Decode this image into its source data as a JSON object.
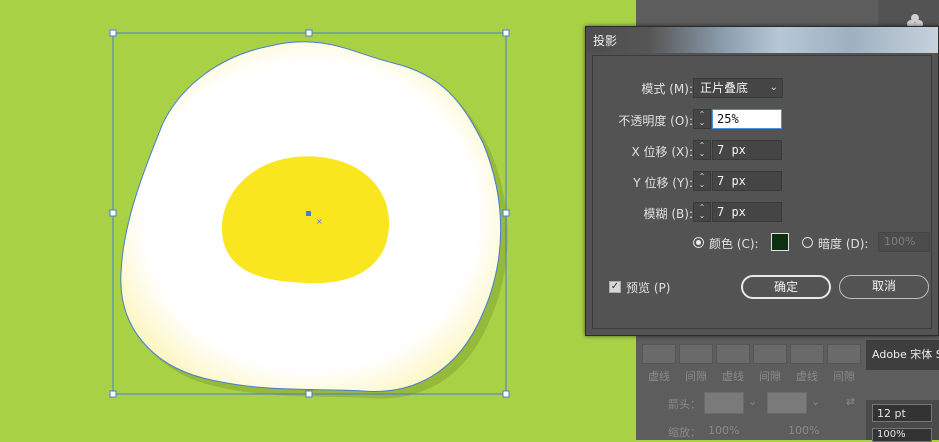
{
  "dialog": {
    "title": "投影",
    "mode_label": "模式 (M):",
    "mode_value": "正片叠底",
    "opacity_label": "不透明度 (O):",
    "opacity_value": "25%",
    "x_offset_label": "X 位移 (X):",
    "x_offset_value": "7 px",
    "y_offset_label": "Y 位移 (Y):",
    "y_offset_value": "7 px",
    "blur_label": "模糊 (B):",
    "blur_value": "7 px",
    "color_option_label": "颜色 (C):",
    "color_swatch": "#0d2f12",
    "darkness_option_label": "暗度 (D):",
    "darkness_value": "100%",
    "preview_label": "预览 (P)",
    "preview_checked": true,
    "ok_label": "确定",
    "cancel_label": "取消"
  },
  "background_panel": {
    "font_row": "Adobe 宋体 S",
    "dash_labels": [
      "虚线",
      "间隙",
      "虚线",
      "间隙",
      "虚线",
      "间隙"
    ],
    "arrow_label": "箭头：",
    "scale_label": "缩放：",
    "scale_value_1": "100%",
    "scale_value_2": "100%",
    "font_size": "12 pt",
    "font_scale": "100%"
  },
  "colors": {
    "artboard_green": "#a9d145",
    "egg_white": "#ffffff",
    "yolk": "#f9e61f",
    "selection_blue": "#4a7bd6"
  },
  "icons": {
    "mode_dropdown": "chevron-down-icon",
    "spinner": "spinner-arrows-icon",
    "club": "club-icon"
  }
}
